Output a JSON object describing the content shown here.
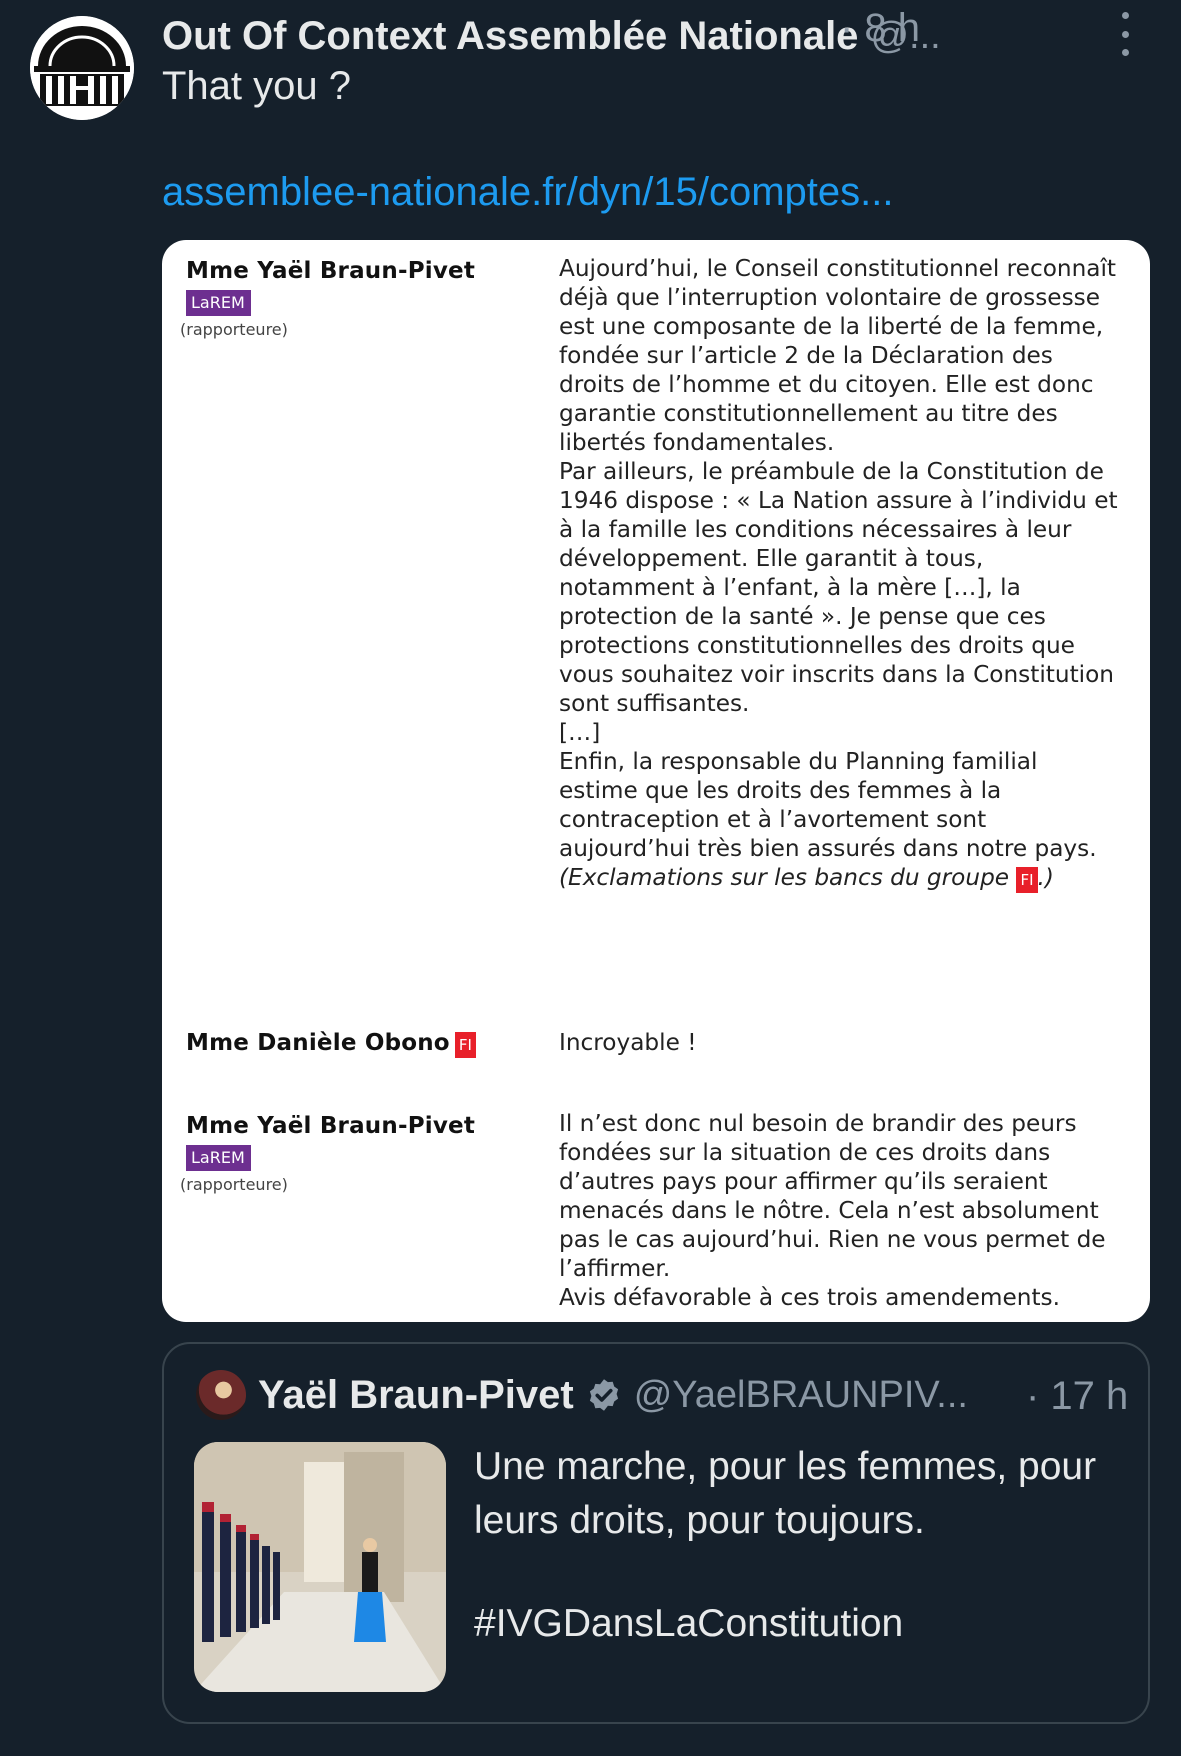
{
  "tweet": {
    "author_name": "Out Of Context Assemblée Nationale",
    "handle": "@...",
    "time": "· 8 h",
    "text": "That you ?",
    "link": "assemblee-nationale.fr/dyn/15/comptes..."
  },
  "document": {
    "entries": [
      {
        "speaker": "Mme Yaël Braun-Pivet",
        "party": "LaREM",
        "role": "(rapporteure)",
        "paragraphs": [
          "Aujourd’hui, le Conseil constitutionnel reconnaît déjà que l’interruption volontaire de grossesse est une composante de la liberté de la femme, fondée sur l’article 2 de la Déclaration des droits de l’homme et du citoyen. Elle est donc garantie constitutionnellement au titre des libertés fondamentales.",
          "Par ailleurs, le préambule de la Constitution de 1946 dispose : « La Nation assure à l’individu et à la famille les conditions nécessaires à leur développement. Elle garantit à tous, notamment à l’enfant, à la mère […], la protection de la santé ». Je pense que ces protections constitutionnelles des droits que vous souhaitez voir inscrits dans la Constitution sont suffisantes.",
          "[…]",
          "Enfin, la responsable du Planning familial estime que les droits des femmes à la contraception et à l’avortement sont aujourd’hui très bien assurés dans notre pays."
        ],
        "stage_direction": "(Exclamations sur les bancs du groupe",
        "stage_badge": "FI",
        "stage_end": ".)"
      },
      {
        "speaker": "Mme Danièle Obono",
        "party": "FI",
        "paragraphs": [
          "Incroyable !"
        ]
      },
      {
        "speaker": "Mme Yaël Braun-Pivet",
        "party": "LaREM",
        "role": "(rapporteure)",
        "paragraphs": [
          "Il n’est donc nul besoin de brandir des peurs fondées sur la situation de ces droits dans d’autres pays pour affirmer qu’ils seraient menacés dans le nôtre. Cela n’est absolument pas le cas aujourd’hui. Rien ne vous permet de l’affirmer.",
          "Avis défavorable à ces trois amendements."
        ]
      }
    ]
  },
  "quoted_tweet": {
    "author_name": "Yaël Braun-Pivet",
    "handle": "@YaelBRAUNPIV...",
    "time": "· 17 h",
    "text": "Une marche, pour les femmes, pour leurs droits, pour toujours.",
    "hashtag": "#IVGDansLaConstitution",
    "verified_icon": "verified-badge-icon"
  },
  "colors": {
    "background": "#15202b",
    "link": "#1d9bf0",
    "secondary_text": "#8b98a5",
    "larem": "#6d2f90",
    "fi": "#e8202a"
  }
}
